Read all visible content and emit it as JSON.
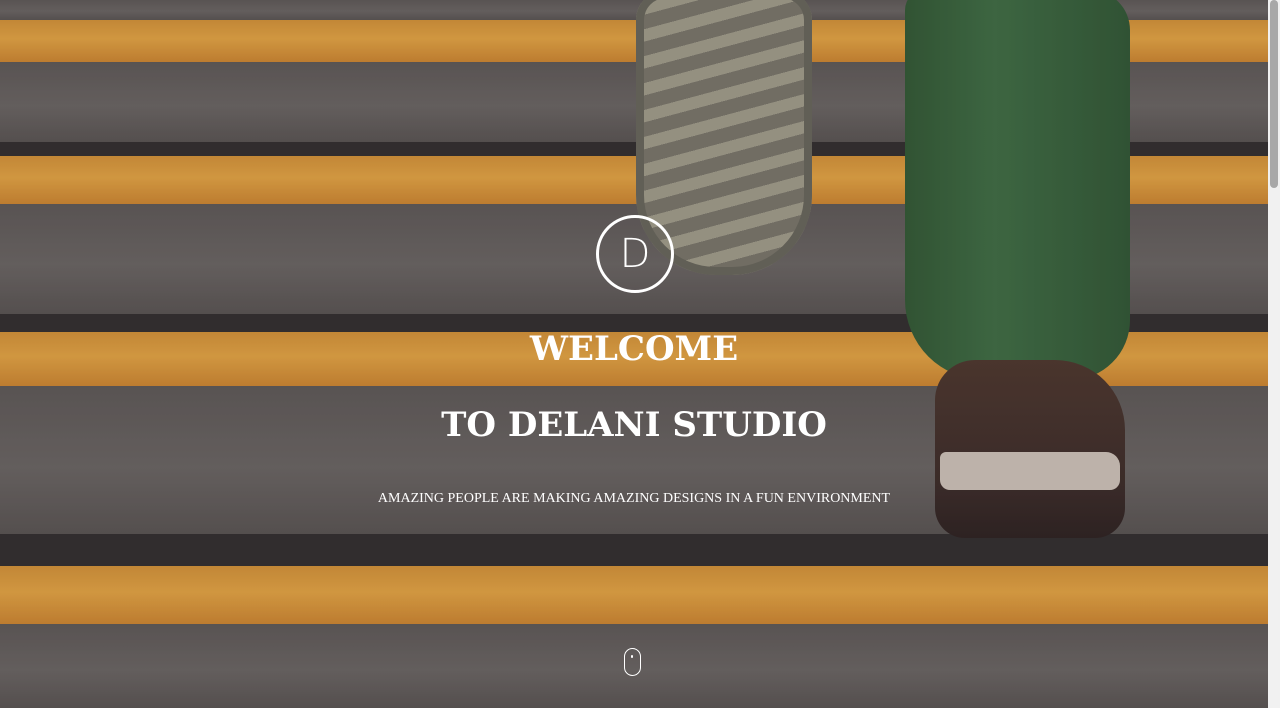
{
  "hero": {
    "logo_letter": "D",
    "title_line_1": "WELCOME",
    "title_line_2": "TO DELANI STUDIO",
    "tagline": "AMAZING PEOPLE ARE MAKING AMAZING DESIGNS IN A FUN ENVIRONMENT"
  },
  "icons": {
    "scroll_indicator": "mouse-scroll-icon"
  },
  "colors": {
    "text": "#ffffff",
    "stripe": "#f1ad3f",
    "scrollbar_thumb": "#a8a8a8"
  }
}
